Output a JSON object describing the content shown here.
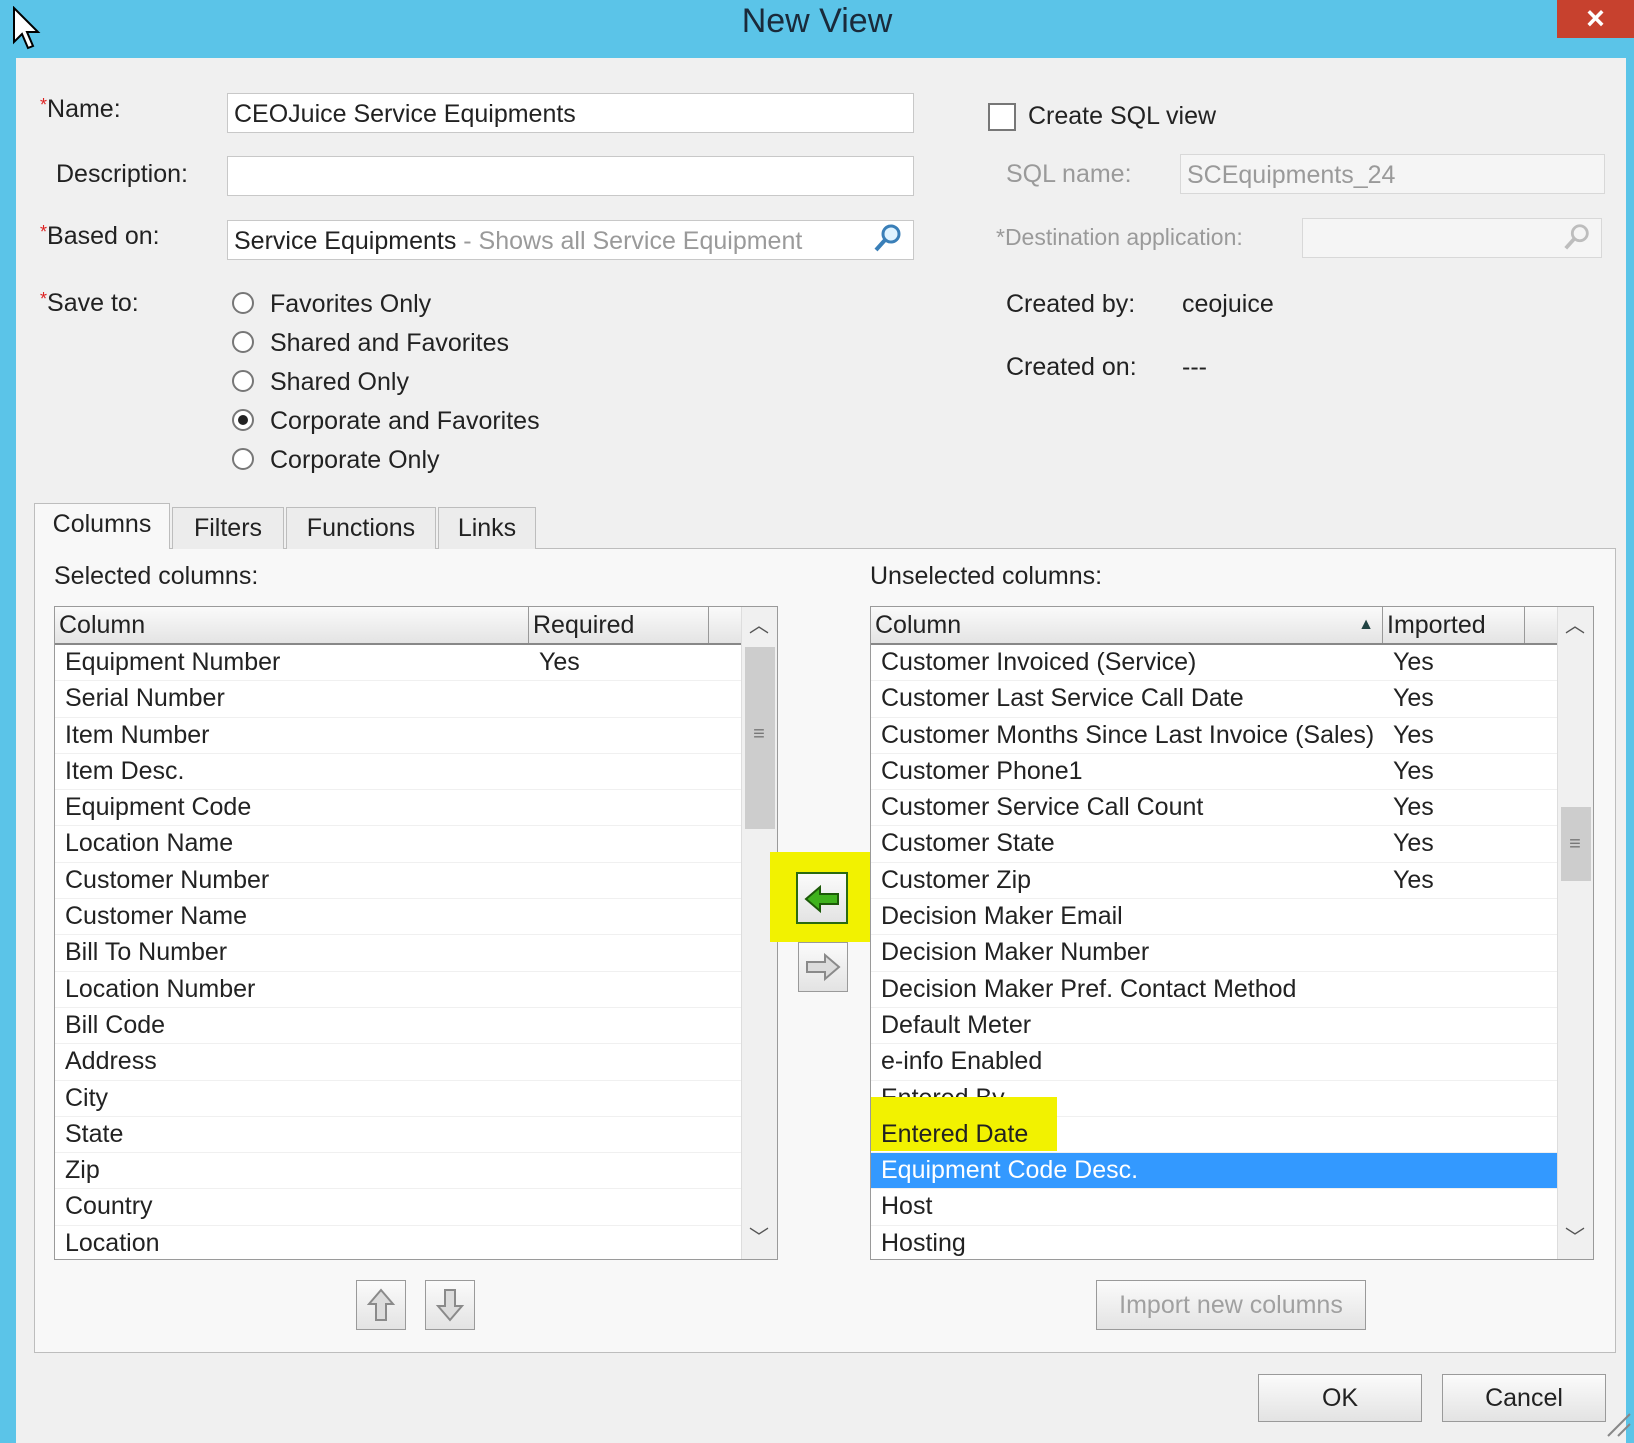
{
  "window": {
    "title": "New View",
    "close_label": "×"
  },
  "form": {
    "name_label": "Name:",
    "name_value": "CEOJuice Service Equipments",
    "description_label": "Description:",
    "description_value": "",
    "based_on_label": "Based on:",
    "based_on_value": "Service Equipments",
    "based_on_hint": " - Shows all Service Equipment",
    "save_to_label": "Save to:",
    "save_to_options": [
      {
        "label": "Favorites Only",
        "selected": false
      },
      {
        "label": "Shared and Favorites",
        "selected": false
      },
      {
        "label": "Shared Only",
        "selected": false
      },
      {
        "label": "Corporate and Favorites",
        "selected": true
      },
      {
        "label": "Corporate Only",
        "selected": false
      }
    ],
    "required_mark": "*"
  },
  "sql": {
    "create_label": "Create SQL view",
    "create_checked": false,
    "sql_name_label": "SQL name:",
    "sql_name_value": "SCEquipments_24",
    "destination_label": "*Destination application:",
    "destination_value": ""
  },
  "meta": {
    "created_by_label": "Created by:",
    "created_by_value": "ceojuice",
    "created_on_label": "Created on:",
    "created_on_value": "---"
  },
  "tabs": [
    {
      "label": "Columns",
      "active": true
    },
    {
      "label": "Filters",
      "active": false
    },
    {
      "label": "Functions",
      "active": false
    },
    {
      "label": "Links",
      "active": false
    }
  ],
  "selected": {
    "label": "Selected columns:",
    "headers": {
      "column": "Column",
      "required": "Required"
    },
    "rows": [
      {
        "column": "Equipment Number",
        "required": "Yes"
      },
      {
        "column": "Serial Number",
        "required": ""
      },
      {
        "column": "Item Number",
        "required": ""
      },
      {
        "column": "Item Desc.",
        "required": ""
      },
      {
        "column": "Equipment Code",
        "required": ""
      },
      {
        "column": "Location Name",
        "required": ""
      },
      {
        "column": "Customer Number",
        "required": ""
      },
      {
        "column": "Customer Name",
        "required": ""
      },
      {
        "column": "Bill To Number",
        "required": ""
      },
      {
        "column": "Location Number",
        "required": ""
      },
      {
        "column": "Bill Code",
        "required": ""
      },
      {
        "column": "Address",
        "required": ""
      },
      {
        "column": "City",
        "required": ""
      },
      {
        "column": "State",
        "required": ""
      },
      {
        "column": "Zip",
        "required": ""
      },
      {
        "column": "Country",
        "required": ""
      },
      {
        "column": "Location",
        "required": ""
      }
    ]
  },
  "unselected": {
    "label": "Unselected columns:",
    "headers": {
      "column": "Column",
      "imported": "Imported"
    },
    "rows": [
      {
        "column": "Customer Invoiced (Service)",
        "imported": "Yes"
      },
      {
        "column": "Customer Last Service Call Date",
        "imported": "Yes"
      },
      {
        "column": "Customer Months Since Last Invoice (Sales)",
        "imported": "Yes"
      },
      {
        "column": "Customer Phone1",
        "imported": "Yes"
      },
      {
        "column": "Customer Service Call Count",
        "imported": "Yes"
      },
      {
        "column": "Customer State",
        "imported": "Yes"
      },
      {
        "column": "Customer Zip",
        "imported": "Yes"
      },
      {
        "column": "Decision Maker Email",
        "imported": ""
      },
      {
        "column": "Decision Maker Number",
        "imported": ""
      },
      {
        "column": "Decision Maker Pref. Contact Method",
        "imported": ""
      },
      {
        "column": "Default Meter",
        "imported": ""
      },
      {
        "column": "e-info Enabled",
        "imported": ""
      },
      {
        "column": "Entered By",
        "imported": ""
      },
      {
        "column": "Entered Date",
        "imported": "",
        "highlight": true
      },
      {
        "column": "Equipment Code Desc.",
        "imported": "",
        "selected": true
      },
      {
        "column": "Host",
        "imported": ""
      },
      {
        "column": "Hosting",
        "imported": ""
      }
    ]
  },
  "buttons": {
    "import_new_columns": "Import new columns",
    "ok": "OK",
    "cancel": "Cancel"
  },
  "icons": {
    "move_left": "arrow-left-icon",
    "move_right": "arrow-right-icon",
    "move_up": "arrow-up-icon",
    "move_down": "arrow-down-icon",
    "search": "search-icon"
  },
  "colors": {
    "titlebar": "#5bc4e8",
    "close": "#c7412e",
    "selection": "#3399ff",
    "highlight": "#f2f200"
  }
}
